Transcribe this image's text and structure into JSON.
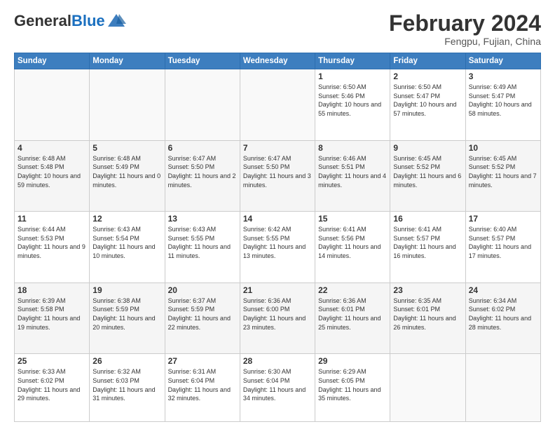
{
  "header": {
    "logo_general": "General",
    "logo_blue": "Blue",
    "month_year": "February 2024",
    "location": "Fengpu, Fujian, China"
  },
  "weekdays": [
    "Sunday",
    "Monday",
    "Tuesday",
    "Wednesday",
    "Thursday",
    "Friday",
    "Saturday"
  ],
  "weeks": [
    [
      {
        "day": "",
        "info": ""
      },
      {
        "day": "",
        "info": ""
      },
      {
        "day": "",
        "info": ""
      },
      {
        "day": "",
        "info": ""
      },
      {
        "day": "1",
        "info": "Sunrise: 6:50 AM\nSunset: 5:46 PM\nDaylight: 10 hours and 55 minutes."
      },
      {
        "day": "2",
        "info": "Sunrise: 6:50 AM\nSunset: 5:47 PM\nDaylight: 10 hours and 57 minutes."
      },
      {
        "day": "3",
        "info": "Sunrise: 6:49 AM\nSunset: 5:47 PM\nDaylight: 10 hours and 58 minutes."
      }
    ],
    [
      {
        "day": "4",
        "info": "Sunrise: 6:48 AM\nSunset: 5:48 PM\nDaylight: 10 hours and 59 minutes."
      },
      {
        "day": "5",
        "info": "Sunrise: 6:48 AM\nSunset: 5:49 PM\nDaylight: 11 hours and 0 minutes."
      },
      {
        "day": "6",
        "info": "Sunrise: 6:47 AM\nSunset: 5:50 PM\nDaylight: 11 hours and 2 minutes."
      },
      {
        "day": "7",
        "info": "Sunrise: 6:47 AM\nSunset: 5:50 PM\nDaylight: 11 hours and 3 minutes."
      },
      {
        "day": "8",
        "info": "Sunrise: 6:46 AM\nSunset: 5:51 PM\nDaylight: 11 hours and 4 minutes."
      },
      {
        "day": "9",
        "info": "Sunrise: 6:45 AM\nSunset: 5:52 PM\nDaylight: 11 hours and 6 minutes."
      },
      {
        "day": "10",
        "info": "Sunrise: 6:45 AM\nSunset: 5:52 PM\nDaylight: 11 hours and 7 minutes."
      }
    ],
    [
      {
        "day": "11",
        "info": "Sunrise: 6:44 AM\nSunset: 5:53 PM\nDaylight: 11 hours and 9 minutes."
      },
      {
        "day": "12",
        "info": "Sunrise: 6:43 AM\nSunset: 5:54 PM\nDaylight: 11 hours and 10 minutes."
      },
      {
        "day": "13",
        "info": "Sunrise: 6:43 AM\nSunset: 5:55 PM\nDaylight: 11 hours and 11 minutes."
      },
      {
        "day": "14",
        "info": "Sunrise: 6:42 AM\nSunset: 5:55 PM\nDaylight: 11 hours and 13 minutes."
      },
      {
        "day": "15",
        "info": "Sunrise: 6:41 AM\nSunset: 5:56 PM\nDaylight: 11 hours and 14 minutes."
      },
      {
        "day": "16",
        "info": "Sunrise: 6:41 AM\nSunset: 5:57 PM\nDaylight: 11 hours and 16 minutes."
      },
      {
        "day": "17",
        "info": "Sunrise: 6:40 AM\nSunset: 5:57 PM\nDaylight: 11 hours and 17 minutes."
      }
    ],
    [
      {
        "day": "18",
        "info": "Sunrise: 6:39 AM\nSunset: 5:58 PM\nDaylight: 11 hours and 19 minutes."
      },
      {
        "day": "19",
        "info": "Sunrise: 6:38 AM\nSunset: 5:59 PM\nDaylight: 11 hours and 20 minutes."
      },
      {
        "day": "20",
        "info": "Sunrise: 6:37 AM\nSunset: 5:59 PM\nDaylight: 11 hours and 22 minutes."
      },
      {
        "day": "21",
        "info": "Sunrise: 6:36 AM\nSunset: 6:00 PM\nDaylight: 11 hours and 23 minutes."
      },
      {
        "day": "22",
        "info": "Sunrise: 6:36 AM\nSunset: 6:01 PM\nDaylight: 11 hours and 25 minutes."
      },
      {
        "day": "23",
        "info": "Sunrise: 6:35 AM\nSunset: 6:01 PM\nDaylight: 11 hours and 26 minutes."
      },
      {
        "day": "24",
        "info": "Sunrise: 6:34 AM\nSunset: 6:02 PM\nDaylight: 11 hours and 28 minutes."
      }
    ],
    [
      {
        "day": "25",
        "info": "Sunrise: 6:33 AM\nSunset: 6:02 PM\nDaylight: 11 hours and 29 minutes."
      },
      {
        "day": "26",
        "info": "Sunrise: 6:32 AM\nSunset: 6:03 PM\nDaylight: 11 hours and 31 minutes."
      },
      {
        "day": "27",
        "info": "Sunrise: 6:31 AM\nSunset: 6:04 PM\nDaylight: 11 hours and 32 minutes."
      },
      {
        "day": "28",
        "info": "Sunrise: 6:30 AM\nSunset: 6:04 PM\nDaylight: 11 hours and 34 minutes."
      },
      {
        "day": "29",
        "info": "Sunrise: 6:29 AM\nSunset: 6:05 PM\nDaylight: 11 hours and 35 minutes."
      },
      {
        "day": "",
        "info": ""
      },
      {
        "day": "",
        "info": ""
      }
    ]
  ]
}
